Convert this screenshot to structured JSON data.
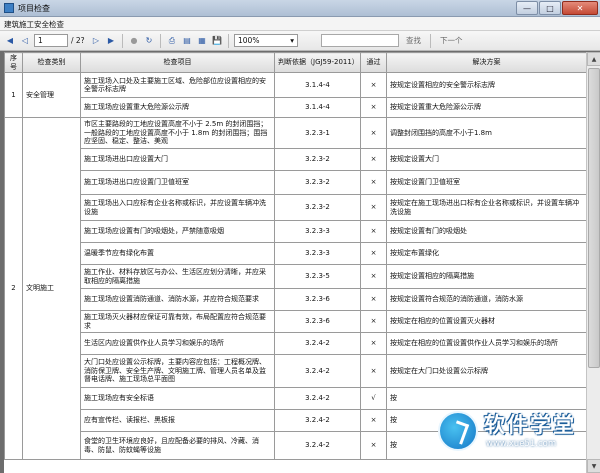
{
  "window": {
    "title": "项目检查",
    "subtitle": "建筑施工安全检查"
  },
  "toolbar": {
    "page_current": "1",
    "page_total": "/ 2?",
    "zoom": "100%",
    "find_label": "查找",
    "next_label": "下一个"
  },
  "table": {
    "headers": [
      "序号",
      "检查类别",
      "检查项目",
      "判断依据（JGJ59-2011）",
      "通过",
      "解决方案"
    ],
    "rows": [
      {
        "no": "1",
        "category": "安全管理",
        "item": "施工现场入口处及主要施工区域、危险部位应设置相应的安全警示标志牌",
        "basis": "3.1.4-4",
        "pass": "×",
        "solution": "按规定设置相应的安全警示标志牌"
      },
      {
        "no": "",
        "category": "",
        "item": "施工现场应设置重大危险源公示牌",
        "basis": "3.1.4-4",
        "pass": "×",
        "solution": "按规定设置重大危险源公示牌"
      },
      {
        "no": "",
        "category": "",
        "item": "市区主要路段的工地应设置高度不小于 2.5m 的封闭围挡；一般路段的工地应设置高度不小于 1.8m 的封闭围挡；围挡应坚固、稳定、整洁、美观",
        "basis": "3.2.3-1",
        "pass": "×",
        "solution": "调整封闭围挡的高度不小于1.8m"
      },
      {
        "no": "",
        "category": "",
        "item": "施工现场进出口应设置大门",
        "basis": "3.2.3-2",
        "pass": "×",
        "solution": "按规定设置大门"
      },
      {
        "no": "",
        "category": "",
        "item": "施工现场进出口应设置门卫值班室",
        "basis": "3.2.3-2",
        "pass": "×",
        "solution": "按规定设置门卫值班室"
      },
      {
        "no": "",
        "category": "",
        "item": "施工现场出入口应标有企业名称或标识，并应设置车辆冲洗设施",
        "basis": "3.2.3-2",
        "pass": "×",
        "solution": "按规定在施工现场进出口标有企业名称或标识，并设置车辆冲洗设施"
      },
      {
        "no": "",
        "category": "",
        "item": "施工现场应设置有门的吸烟处，严禁随意吸烟",
        "basis": "3.2.3-3",
        "pass": "×",
        "solution": "按规定设置有门的吸烟处"
      },
      {
        "no": "",
        "category": "",
        "item": "温暖季节应有绿化布置",
        "basis": "3.2.3-3",
        "pass": "×",
        "solution": "按规定布置绿化"
      },
      {
        "no": "",
        "category": "",
        "item": "施工作业、材料存放区与办公、生活区应划分清晰，并应采取相应的隔离措施",
        "basis": "3.2.3-5",
        "pass": "×",
        "solution": "按规定设置相应的隔离措施"
      },
      {
        "no": "2",
        "category": "文明施工",
        "item": "施工现场应设置消防通道、消防水源，并应符合规范要求",
        "basis": "3.2.3-6",
        "pass": "×",
        "solution": "按规定设置符合规范的消防通道，消防水源"
      },
      {
        "no": "",
        "category": "",
        "item": "施工现场灭火器材应保证可靠有效，布局配置应符合规范要求",
        "basis": "3.2.3-6",
        "pass": "×",
        "solution": "按规定在相应的位置设置灭火器材"
      },
      {
        "no": "",
        "category": "",
        "item": "生活区内应设置供作业人员学习和娱乐的场所",
        "basis": "3.2.4-2",
        "pass": "×",
        "solution": "按规定在相应的位置设置供作业人员学习和娱乐的场所"
      },
      {
        "no": "",
        "category": "",
        "item": "大门口处应设置公示标牌，主要内容应包括：工程概况牌、消防保卫牌、安全生产牌、文明施工牌、管理人员名单及监督电话牌、施工现场总平面图",
        "basis": "3.2.4-2",
        "pass": "×",
        "solution": "按规定在大门口处设置公示标牌"
      },
      {
        "no": "",
        "category": "",
        "item": "施工现场应有安全标语",
        "basis": "3.2.4-2",
        "pass": "√",
        "solution": "按"
      },
      {
        "no": "",
        "category": "",
        "item": "应有宣传栏、读报栏、黑板报",
        "basis": "3.2.4-2",
        "pass": "×",
        "solution": "按"
      },
      {
        "no": "",
        "category": "",
        "item": "食堂的卫生环境应良好，且应配备必要的排风、冷藏、消毒、防鼠、防蚊蝇等设施",
        "basis": "3.2.4-2",
        "pass": "×",
        "solution": "按"
      }
    ]
  },
  "watermark": {
    "title": "软件学堂",
    "url": "www.xue51.com"
  },
  "icons": {
    "accent": "#2b59a5",
    "watermark_blue": "#1476c6"
  }
}
